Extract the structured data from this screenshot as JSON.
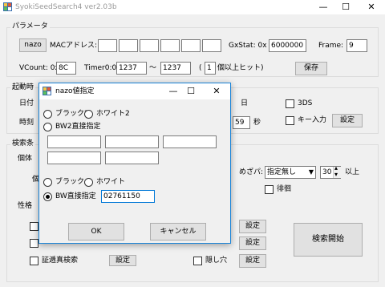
{
  "window": {
    "title": "SyokiSeedSearch4 ver2.03b",
    "minimize": "—",
    "maximize": "☐",
    "close": "✕"
  },
  "params": {
    "group_label": "パラメータ",
    "nazo_button": "nazo",
    "mac_label": "MACアドレス:",
    "mac_values": [
      "",
      "",
      "",
      "",
      "",
      ""
    ],
    "gxstat_label": "GxStat: 0x",
    "gxstat_value": "6000000",
    "frame_label": "Frame:",
    "frame_value": "9",
    "vcount_label": "VCount: 0x",
    "vcount_value": "8C",
    "timer0_label": "Timer0:0x",
    "timer0_from": "1237",
    "tilde": "〜",
    "timer0_to": "1237",
    "paren_open": "(",
    "count_value": "1",
    "count_suffix": "個以上ヒット)",
    "save_button": "保存"
  },
  "startup": {
    "group_label": "起動時",
    "date_label": "日付",
    "time_label": "時刻",
    "day_suffix": "日",
    "sec_value": "59",
    "sec_suffix": "秒",
    "ds3_label": "3DS",
    "key_input_label": "キー入力",
    "settings_button": "設定"
  },
  "search": {
    "group_label": "検索条",
    "indiv_label": "個体",
    "indiv2_label": "個",
    "nature_label": "性格",
    "gender_label": "めざパ:",
    "gender_value": "指定無し",
    "min_value": "30",
    "min_suffix": "以上",
    "wandering_label": "徘徊",
    "settings_1": "設定",
    "settings_2": "設定",
    "settings_3": "設定",
    "settings_4": "設定",
    "chain_label": "証逓真検索",
    "hidden_label": "隠し穴",
    "start_button": "検索開始"
  },
  "dialog": {
    "title": "nazo値指定",
    "minimize": "—",
    "maximize": "☐",
    "close": "✕",
    "radio_black2": "ブラック2",
    "radio_white2": "ホワイト2",
    "radio_bw2_direct": "BW2直接指定",
    "radio_black": "ブラック",
    "radio_white": "ホワイト",
    "radio_bw_direct": "BW直接指定",
    "bw_direct_value": "02761150",
    "ok_button": "OK",
    "cancel_button": "キャンセル",
    "bw2_fields": [
      "",
      "",
      "",
      "",
      ""
    ]
  }
}
